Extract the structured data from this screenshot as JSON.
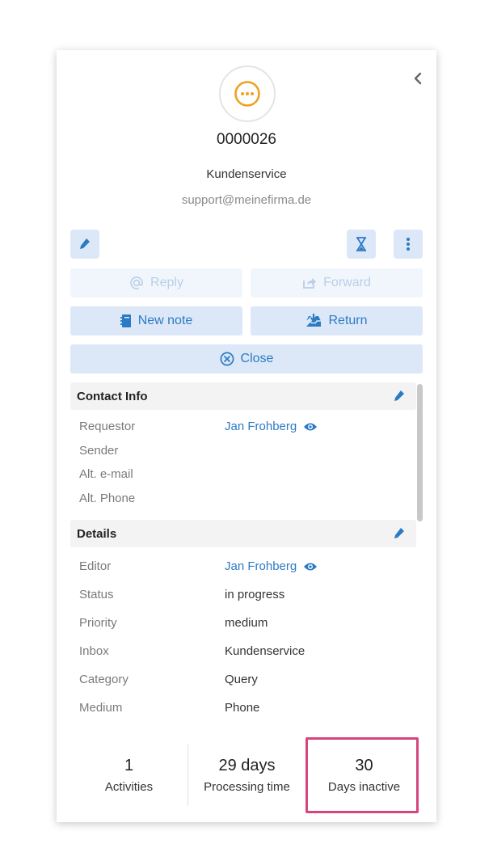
{
  "ticket": {
    "id": "0000026",
    "inbox_name": "Kundenservice",
    "inbox_email": "support@meinefirma.de"
  },
  "actions": {
    "reply": "Reply",
    "forward": "Forward",
    "new_note": "New note",
    "return": "Return",
    "close": "Close"
  },
  "contact_info": {
    "title": "Contact Info",
    "rows": [
      {
        "label": "Requestor",
        "value": "Jan Frohberg"
      },
      {
        "label": "Sender",
        "value": ""
      },
      {
        "label": "Alt. e-mail",
        "value": ""
      },
      {
        "label": "Alt. Phone",
        "value": ""
      }
    ]
  },
  "details": {
    "title": "Details",
    "rows": [
      {
        "label": "Editor",
        "value": "Jan Frohberg"
      },
      {
        "label": "Status",
        "value": "in progress"
      },
      {
        "label": "Priority",
        "value": "medium"
      },
      {
        "label": "Inbox",
        "value": "Kundenservice"
      },
      {
        "label": "Category",
        "value": "Query"
      },
      {
        "label": "Medium",
        "value": "Phone"
      }
    ]
  },
  "stats": [
    {
      "num": "1",
      "label": "Activities"
    },
    {
      "num": "29 days",
      "label": "Processing time"
    },
    {
      "num": "30",
      "label": "Days inactive"
    }
  ],
  "colors": {
    "accent": "#2b7bc4",
    "status_icon": "#f0a020",
    "highlight": "#d6457d"
  },
  "icons": {
    "status": "more-dots-icon",
    "collapse": "chevron-left-icon",
    "edit": "pencil-icon",
    "snooze": "hourglass-icon",
    "more": "vertical-dots-icon",
    "view": "eye-icon"
  }
}
